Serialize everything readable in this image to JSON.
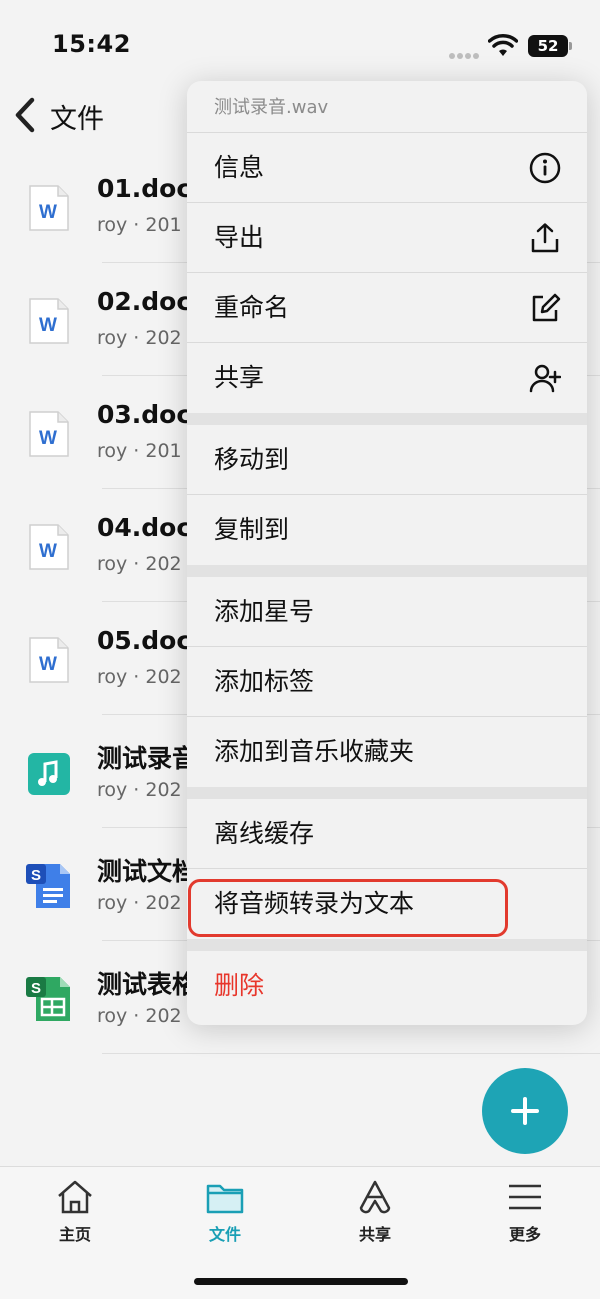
{
  "status_bar": {
    "time": "15:42",
    "battery": "52"
  },
  "header": {
    "title": "文件"
  },
  "files": [
    {
      "name": "01.doc",
      "meta": "roy · 201",
      "icon": "word-doc-icon"
    },
    {
      "name": "02.doc",
      "meta": "roy · 202",
      "icon": "word-doc-icon"
    },
    {
      "name": "03.doc",
      "meta": "roy · 201",
      "icon": "word-doc-icon"
    },
    {
      "name": "04.doc",
      "meta": "roy · 202",
      "icon": "word-doc-icon"
    },
    {
      "name": "05.doc",
      "meta": "roy · 202",
      "icon": "word-doc-icon"
    },
    {
      "name": "测试录音",
      "meta": "roy · 202",
      "icon": "audio-file-icon"
    },
    {
      "name": "测试文档",
      "meta": "roy · 202",
      "icon": "google-doc-icon"
    },
    {
      "name": "测试表格",
      "meta": "roy · 202",
      "icon": "google-sheet-icon"
    }
  ],
  "context_menu": {
    "title": "测试录音.wav",
    "groups": [
      [
        {
          "label": "信息",
          "icon": "info-icon"
        },
        {
          "label": "导出",
          "icon": "export-icon"
        },
        {
          "label": "重命名",
          "icon": "rename-icon"
        },
        {
          "label": "共享",
          "icon": "add-person-icon"
        }
      ],
      [
        {
          "label": "移动到"
        },
        {
          "label": "复制到"
        }
      ],
      [
        {
          "label": "添加星号"
        },
        {
          "label": "添加标签"
        },
        {
          "label": "添加到音乐收藏夹"
        }
      ],
      [
        {
          "label": "离线缓存"
        },
        {
          "label": "将音频转录为文本"
        }
      ],
      [
        {
          "label": "删除"
        }
      ]
    ]
  },
  "tabs": [
    {
      "label": "主页",
      "icon": "home-icon"
    },
    {
      "label": "文件",
      "icon": "folder-icon"
    },
    {
      "label": "共享",
      "icon": "share-icon"
    },
    {
      "label": "更多",
      "icon": "menu-icon"
    }
  ],
  "colors": {
    "accent": "#1ea4b5",
    "danger": "#e8362b",
    "highlight": "#e23a2e"
  }
}
